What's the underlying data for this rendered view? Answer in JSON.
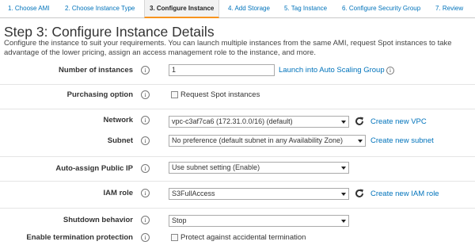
{
  "tabs": [
    {
      "label": "1. Choose AMI"
    },
    {
      "label": "2. Choose Instance Type"
    },
    {
      "label": "3. Configure Instance"
    },
    {
      "label": "4. Add Storage"
    },
    {
      "label": "5. Tag Instance"
    },
    {
      "label": "6. Configure Security Group"
    },
    {
      "label": "7. Review"
    }
  ],
  "active_tab": 2,
  "page": {
    "title": "Step 3: Configure Instance Details",
    "description": "Configure the instance to suit your requirements. You can launch multiple instances from the same AMI, request Spot instances to take advantage of the lower pricing, assign an access management role to the instance, and more."
  },
  "info_glyph": "i",
  "form": {
    "number_of_instances": {
      "label": "Number of instances",
      "value": "1",
      "link": "Launch into Auto Scaling Group"
    },
    "purchasing_option": {
      "label": "Purchasing option",
      "checkbox_label": "Request Spot instances",
      "checked": false
    },
    "network": {
      "label": "Network",
      "value": "vpc-c3af7ca6 (172.31.0.0/16) (default)",
      "link": "Create new VPC"
    },
    "subnet": {
      "label": "Subnet",
      "value": "No preference (default subnet in any Availability Zone)",
      "link": "Create new subnet"
    },
    "public_ip": {
      "label": "Auto-assign Public IP",
      "value": "Use subnet setting (Enable)"
    },
    "iam_role": {
      "label": "IAM role",
      "value": "S3FullAccess",
      "link": "Create new IAM role"
    },
    "shutdown": {
      "label": "Shutdown behavior",
      "value": "Stop"
    },
    "termination": {
      "label": "Enable termination protection",
      "checkbox_label": "Protect against accidental termination",
      "checked": false
    }
  },
  "colors": {
    "link": "#0073bb",
    "active_tab_underline": "#f7941e",
    "refresh_icon": "#333333"
  }
}
